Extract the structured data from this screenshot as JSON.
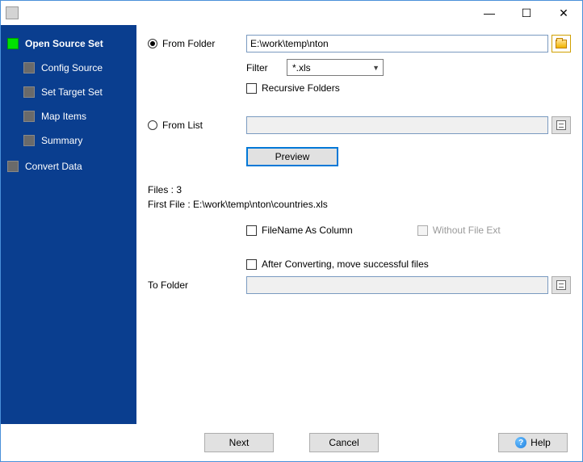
{
  "titlebar": {
    "minimize": "—",
    "maximize": "☐",
    "close": "✕"
  },
  "sidebar": {
    "items": [
      {
        "label": "Open Source Set",
        "active": true,
        "bold": true
      },
      {
        "label": "Config Source"
      },
      {
        "label": "Set Target Set"
      },
      {
        "label": "Map Items"
      },
      {
        "label": "Summary"
      }
    ],
    "footer_item": {
      "label": "Convert Data"
    }
  },
  "main": {
    "from_folder_label": "From Folder",
    "from_folder_value": "E:\\work\\temp\\nton",
    "filter_label": "Filter",
    "filter_value": "*.xls",
    "recursive_label": "Recursive Folders",
    "from_list_label": "From List",
    "from_list_value": "",
    "preview_label": "Preview",
    "files_count_label": "Files : 3",
    "first_file_label": "First File : E:\\work\\temp\\nton\\countries.xls",
    "filename_col_label": "FileName As Column",
    "without_ext_label": "Without File Ext",
    "after_convert_label": "After Converting, move successful files",
    "to_folder_label": "To Folder",
    "to_folder_value": ""
  },
  "footer": {
    "next": "Next",
    "cancel": "Cancel",
    "help": "Help"
  }
}
